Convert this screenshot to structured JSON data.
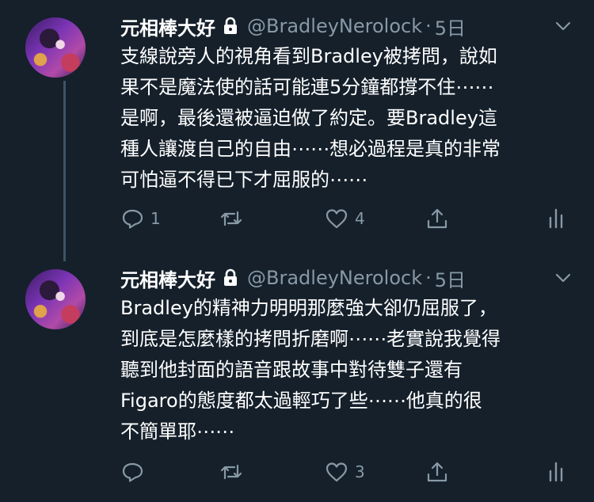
{
  "tweets": [
    {
      "display_name": "元相棒大好",
      "handle": "@BradleyNerolock",
      "separator": "·",
      "time": "5日",
      "lines": [
        "支線說旁人的視角看到Bradley被拷問，說如",
        "果不是魔法使的話可能連5分鐘都撐不住⋯⋯",
        "是啊，最後還被逼迫做了約定。要Bradley這",
        "種人讓渡自己的自由⋯⋯想必過程是真的非常",
        "可怕逼不得已下才屈服的⋯⋯"
      ],
      "reply_count": "1",
      "retweet_count": "",
      "like_count": "4"
    },
    {
      "display_name": "元相棒大好",
      "handle": "@BradleyNerolock",
      "separator": "·",
      "time": "5日",
      "lines": [
        "Bradley的精神力明明那麼強大卻仍屈服了，",
        "到底是怎麼樣的拷問折磨啊⋯⋯老實說我覺得",
        "聽到他封面的語音跟故事中對待雙子還有",
        "Figaro的態度都太過輕巧了些⋯⋯他真的很",
        "不簡單耶⋯⋯"
      ],
      "reply_count": "",
      "retweet_count": "",
      "like_count": "3"
    }
  ],
  "icons": [
    "lock-icon",
    "chevron-down-icon",
    "reply-icon",
    "retweet-icon",
    "like-icon",
    "share-icon",
    "analytics-icon"
  ],
  "colors": {
    "background": "#15202b",
    "text": "#ffffff",
    "muted": "#8899a6",
    "thread_line": "#3d5466"
  }
}
